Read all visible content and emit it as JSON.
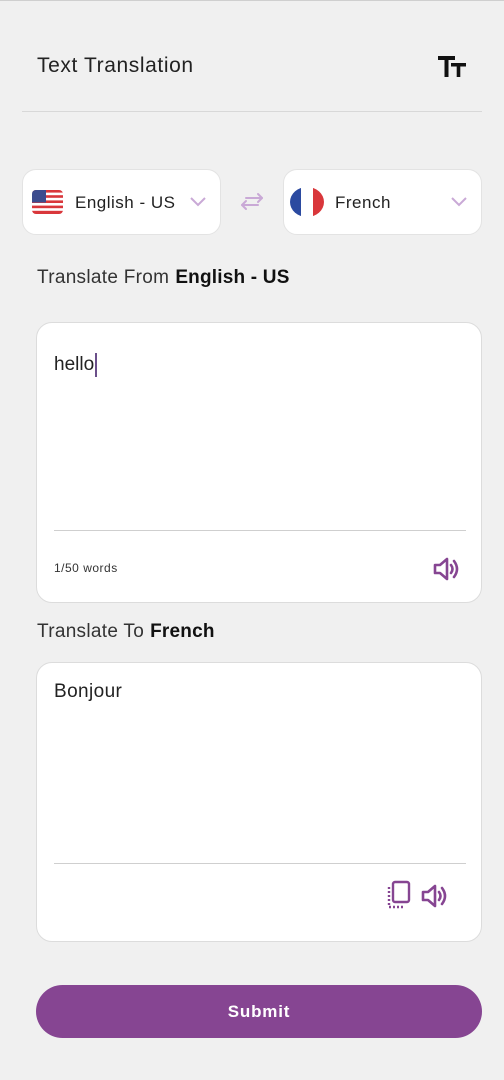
{
  "header": {
    "title": "Text Translation",
    "text_size_icon": "text-size-icon"
  },
  "languages": {
    "from": {
      "name": "English - US",
      "flag_icon": "us-flag-icon"
    },
    "to": {
      "name": "French",
      "flag_icon": "france-flag-icon"
    },
    "swap_icon": "swap-icon"
  },
  "source": {
    "label_prefix": "Translate From",
    "label_lang": "English - US",
    "input_value": "hello",
    "word_count": "1/50 words",
    "speaker_icon": "speaker-icon"
  },
  "target": {
    "label_prefix": "Translate To",
    "label_lang": "French",
    "output_value": "Bonjour",
    "copy_icon": "copy-icon",
    "speaker_icon": "speaker-icon"
  },
  "submit_label": "Submit",
  "colors": {
    "accent": "#864592",
    "accent_light": "#c9a9d6",
    "background": "#f0f0f0"
  }
}
